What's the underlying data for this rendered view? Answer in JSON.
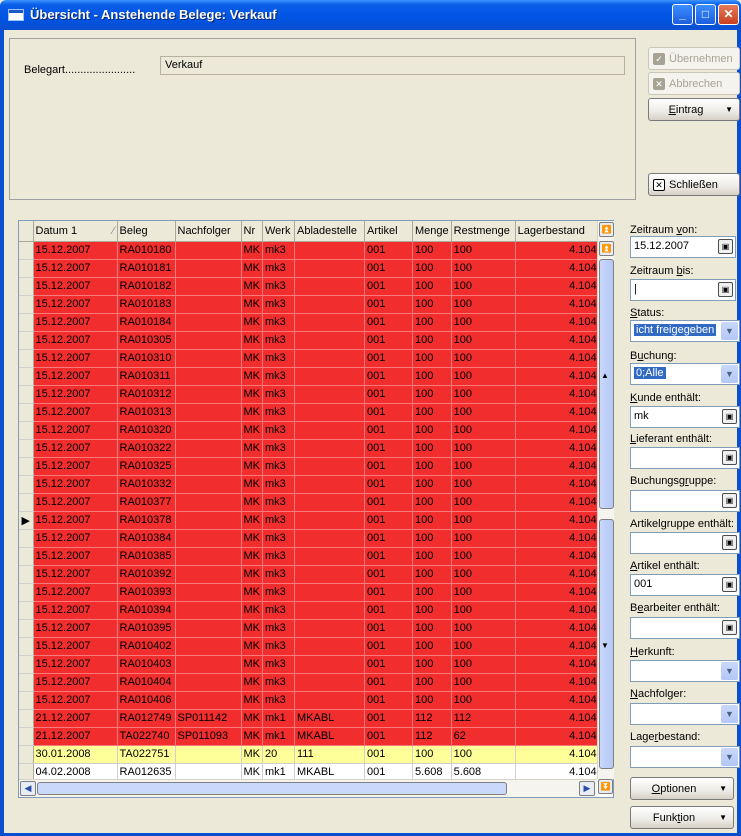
{
  "window": {
    "title": "Übersicht - Anstehende Belege: Verkauf"
  },
  "header": {
    "belegart_label": "Belegart.......................",
    "belegart_value": "Verkauf"
  },
  "actions": {
    "uebernehmen": "Übernehmen",
    "abbrechen": "Abbrechen",
    "eintrag": "Eintrag",
    "schliessen": "Schließen",
    "optionen": "Optionen",
    "funktion": "Funktion"
  },
  "grid": {
    "columns": [
      "Datum 1",
      "Beleg",
      "Nachfolger",
      "Nr",
      "Werk",
      "Abladestelle",
      "Artikel",
      "Menge",
      "Restmenge",
      "Lagerbestand"
    ],
    "selected_row_index": 15,
    "rows": [
      {
        "status": "red",
        "cells": [
          "15.12.2007",
          "RA010180",
          "",
          "MK",
          "mk3",
          "",
          "001",
          "100",
          "100",
          "4.104"
        ]
      },
      {
        "status": "red",
        "cells": [
          "15.12.2007",
          "RA010181",
          "",
          "MK",
          "mk3",
          "",
          "001",
          "100",
          "100",
          "4.104"
        ]
      },
      {
        "status": "red",
        "cells": [
          "15.12.2007",
          "RA010182",
          "",
          "MK",
          "mk3",
          "",
          "001",
          "100",
          "100",
          "4.104"
        ]
      },
      {
        "status": "red",
        "cells": [
          "15.12.2007",
          "RA010183",
          "",
          "MK",
          "mk3",
          "",
          "001",
          "100",
          "100",
          "4.104"
        ]
      },
      {
        "status": "red",
        "cells": [
          "15.12.2007",
          "RA010184",
          "",
          "MK",
          "mk3",
          "",
          "001",
          "100",
          "100",
          "4.104"
        ]
      },
      {
        "status": "red",
        "cells": [
          "15.12.2007",
          "RA010305",
          "",
          "MK",
          "mk3",
          "",
          "001",
          "100",
          "100",
          "4.104"
        ]
      },
      {
        "status": "red",
        "cells": [
          "15.12.2007",
          "RA010310",
          "",
          "MK",
          "mk3",
          "",
          "001",
          "100",
          "100",
          "4.104"
        ]
      },
      {
        "status": "red",
        "cells": [
          "15.12.2007",
          "RA010311",
          "",
          "MK",
          "mk3",
          "",
          "001",
          "100",
          "100",
          "4.104"
        ]
      },
      {
        "status": "red",
        "cells": [
          "15.12.2007",
          "RA010312",
          "",
          "MK",
          "mk3",
          "",
          "001",
          "100",
          "100",
          "4.104"
        ]
      },
      {
        "status": "red",
        "cells": [
          "15.12.2007",
          "RA010313",
          "",
          "MK",
          "mk3",
          "",
          "001",
          "100",
          "100",
          "4.104"
        ]
      },
      {
        "status": "red",
        "cells": [
          "15.12.2007",
          "RA010320",
          "",
          "MK",
          "mk3",
          "",
          "001",
          "100",
          "100",
          "4.104"
        ]
      },
      {
        "status": "red",
        "cells": [
          "15.12.2007",
          "RA010322",
          "",
          "MK",
          "mk3",
          "",
          "001",
          "100",
          "100",
          "4.104"
        ]
      },
      {
        "status": "red",
        "cells": [
          "15.12.2007",
          "RA010325",
          "",
          "MK",
          "mk3",
          "",
          "001",
          "100",
          "100",
          "4.104"
        ]
      },
      {
        "status": "red",
        "cells": [
          "15.12.2007",
          "RA010332",
          "",
          "MK",
          "mk3",
          "",
          "001",
          "100",
          "100",
          "4.104"
        ]
      },
      {
        "status": "red",
        "cells": [
          "15.12.2007",
          "RA010377",
          "",
          "MK",
          "mk3",
          "",
          "001",
          "100",
          "100",
          "4.104"
        ]
      },
      {
        "status": "red",
        "cells": [
          "15.12.2007",
          "RA010378",
          "",
          "MK",
          "mk3",
          "",
          "001",
          "100",
          "100",
          "4.104"
        ]
      },
      {
        "status": "red",
        "cells": [
          "15.12.2007",
          "RA010384",
          "",
          "MK",
          "mk3",
          "",
          "001",
          "100",
          "100",
          "4.104"
        ]
      },
      {
        "status": "red",
        "cells": [
          "15.12.2007",
          "RA010385",
          "",
          "MK",
          "mk3",
          "",
          "001",
          "100",
          "100",
          "4.104"
        ]
      },
      {
        "status": "red",
        "cells": [
          "15.12.2007",
          "RA010392",
          "",
          "MK",
          "mk3",
          "",
          "001",
          "100",
          "100",
          "4.104"
        ]
      },
      {
        "status": "red",
        "cells": [
          "15.12.2007",
          "RA010393",
          "",
          "MK",
          "mk3",
          "",
          "001",
          "100",
          "100",
          "4.104"
        ]
      },
      {
        "status": "red",
        "cells": [
          "15.12.2007",
          "RA010394",
          "",
          "MK",
          "mk3",
          "",
          "001",
          "100",
          "100",
          "4.104"
        ]
      },
      {
        "status": "red",
        "cells": [
          "15.12.2007",
          "RA010395",
          "",
          "MK",
          "mk3",
          "",
          "001",
          "100",
          "100",
          "4.104"
        ]
      },
      {
        "status": "red",
        "cells": [
          "15.12.2007",
          "RA010402",
          "",
          "MK",
          "mk3",
          "",
          "001",
          "100",
          "100",
          "4.104"
        ]
      },
      {
        "status": "red",
        "cells": [
          "15.12.2007",
          "RA010403",
          "",
          "MK",
          "mk3",
          "",
          "001",
          "100",
          "100",
          "4.104"
        ]
      },
      {
        "status": "red",
        "cells": [
          "15.12.2007",
          "RA010404",
          "",
          "MK",
          "mk3",
          "",
          "001",
          "100",
          "100",
          "4.104"
        ]
      },
      {
        "status": "red",
        "cells": [
          "15.12.2007",
          "RA010406",
          "",
          "MK",
          "mk3",
          "",
          "001",
          "100",
          "100",
          "4.104"
        ]
      },
      {
        "status": "red",
        "cells": [
          "21.12.2007",
          "RA012749",
          "SP011142",
          "MK",
          "mk1",
          "MKABL",
          "001",
          "112",
          "112",
          "4.104"
        ]
      },
      {
        "status": "red",
        "cells": [
          "21.12.2007",
          "TA022740",
          "SP011093",
          "MK",
          "mk1",
          "MKABL",
          "001",
          "112",
          "62",
          "4.104"
        ]
      },
      {
        "status": "yellow",
        "cells": [
          "30.01.2008",
          "TA022751",
          "",
          "MK",
          "20",
          "111",
          "001",
          "100",
          "100",
          "4.104"
        ]
      },
      {
        "status": "white",
        "cells": [
          "04.02.2008",
          "RA012635",
          "",
          "MK",
          "mk1",
          "MKABL",
          "001",
          "5.608",
          "5.608",
          "4.104"
        ]
      }
    ]
  },
  "filters": {
    "zeitraum_von": {
      "label_pre": "Zeitraum ",
      "label_u": "v",
      "label_post": "on:",
      "value": "15.12.2007"
    },
    "zeitraum_bis": {
      "label_pre": "Zeitraum ",
      "label_u": "b",
      "label_post": "is:",
      "value": "|"
    },
    "status": {
      "label_pre": "",
      "label_u": "S",
      "label_post": "tatus:",
      "value": "icht freigegeben"
    },
    "buchung": {
      "label_pre": "B",
      "label_u": "u",
      "label_post": "chung:",
      "value": "0;Alle"
    },
    "kunde": {
      "label_pre": "",
      "label_u": "K",
      "label_post": "unde enthält:",
      "value": "mk"
    },
    "lieferant": {
      "label_pre": "",
      "label_u": "L",
      "label_post": "ieferant enthält:",
      "value": ""
    },
    "buchungsgruppe": {
      "label_pre": "Buchungsg",
      "label_u": "r",
      "label_post": "uppe:",
      "value": ""
    },
    "artikelgruppe": {
      "label_pre": "Artikel",
      "label_u": "g",
      "label_post": "ruppe enthält:",
      "value": ""
    },
    "artikel": {
      "label_pre": "",
      "label_u": "A",
      "label_post": "rtikel enthält:",
      "value": "001"
    },
    "bearbeiter": {
      "label_pre": "B",
      "label_u": "e",
      "label_post": "arbeiter enthält:",
      "value": ""
    },
    "herkunft": {
      "label_pre": "",
      "label_u": "H",
      "label_post": "erkunft:",
      "value": ""
    },
    "nachfolger": {
      "label_pre": "",
      "label_u": "N",
      "label_post": "achfolger:",
      "value": ""
    },
    "lagerbestand": {
      "label_pre": "Lage",
      "label_u": "r",
      "label_post": "bestand:",
      "value": ""
    }
  },
  "colors": {
    "title_bar": "#0054e3",
    "row_red": "#f12d2d",
    "row_yellow": "#ffff99",
    "selection": "#316ac5"
  }
}
